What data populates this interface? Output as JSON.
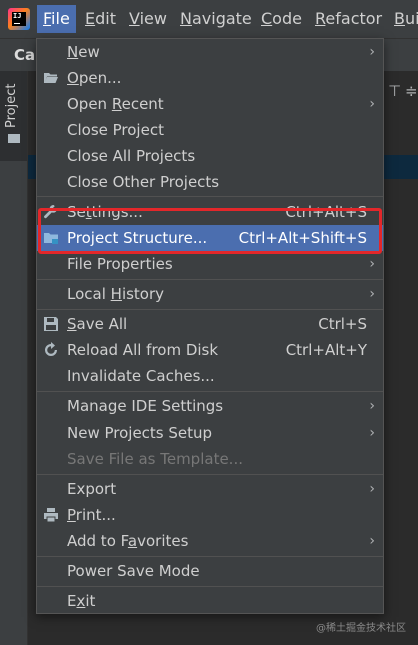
{
  "menubar": {
    "items": [
      {
        "label": "File",
        "mnemonic": "F",
        "rest": "ile"
      },
      {
        "label": "Edit",
        "mnemonic": "E",
        "rest": "dit"
      },
      {
        "label": "View",
        "mnemonic": "V",
        "rest": "iew"
      },
      {
        "label": "Navigate",
        "mnemonic": "N",
        "rest": "avigate"
      },
      {
        "label": "Code",
        "mnemonic": "C",
        "rest": "ode"
      },
      {
        "label": "Refactor",
        "mnemonic": "R",
        "rest": "efactor"
      },
      {
        "label": "Bui",
        "mnemonic": "B",
        "rest": "ui"
      }
    ]
  },
  "background": {
    "tab_text": "Ca",
    "tool_window_label": "Project"
  },
  "file_menu": {
    "items": [
      {
        "label": "New",
        "pre": "",
        "mn": "N",
        "post": "ew",
        "submenu": true
      },
      {
        "label": "Open...",
        "pre": "",
        "mn": "O",
        "post": "pen...",
        "icon": "folder-open-icon"
      },
      {
        "label": "Open Recent",
        "pre": "Open ",
        "mn": "R",
        "post": "ecent",
        "submenu": true
      },
      {
        "label": "Close Project",
        "pre": "Close Project",
        "mn": "",
        "post": ""
      },
      {
        "label": "Close All Projects",
        "pre": "Close All Projects",
        "mn": "",
        "post": ""
      },
      {
        "label": "Close Other Projects",
        "pre": "Close Other Projects",
        "mn": "",
        "post": ""
      },
      {
        "label": "Settings...",
        "pre": "Se",
        "mn": "t",
        "post": "tings...",
        "shortcut": "Ctrl+Alt+S",
        "icon": "wrench-icon"
      },
      {
        "label": "Project Structure...",
        "pre": "Project Structure...",
        "mn": "",
        "post": "",
        "shortcut": "Ctrl+Alt+Shift+S",
        "icon": "project-structure-icon",
        "highlighted": true
      },
      {
        "label": "File Properties",
        "pre": "File Properties",
        "mn": "",
        "post": "",
        "submenu": true
      },
      {
        "label": "Local History",
        "pre": "Local ",
        "mn": "H",
        "post": "istory",
        "submenu": true
      },
      {
        "label": "Save All",
        "pre": "",
        "mn": "S",
        "post": "ave All",
        "shortcut": "Ctrl+S",
        "icon": "save-icon"
      },
      {
        "label": "Reload All from Disk",
        "pre": "Reload All from Disk",
        "mn": "",
        "post": "",
        "shortcut": "Ctrl+Alt+Y",
        "icon": "reload-icon"
      },
      {
        "label": "Invalidate Caches...",
        "pre": "Invalidate Caches...",
        "mn": "",
        "post": ""
      },
      {
        "label": "Manage IDE Settings",
        "pre": "Manage IDE Settings",
        "mn": "",
        "post": "",
        "submenu": true
      },
      {
        "label": "New Projects Setup",
        "pre": "New Projects Setup",
        "mn": "",
        "post": "",
        "submenu": true
      },
      {
        "label": "Save File as Template...",
        "pre": "Save File as Template...",
        "mn": "",
        "post": "",
        "disabled": true
      },
      {
        "label": "Export",
        "pre": "Export",
        "mn": "",
        "post": "",
        "submenu": true
      },
      {
        "label": "Print...",
        "pre": "",
        "mn": "P",
        "post": "rint...",
        "icon": "print-icon"
      },
      {
        "label": "Add to Favorites",
        "pre": "Add to F",
        "mn": "a",
        "post": "vorites",
        "submenu": true
      },
      {
        "label": "Power Save Mode",
        "pre": "Power Save Mode",
        "mn": "",
        "post": ""
      },
      {
        "label": "Exit",
        "pre": "E",
        "mn": "x",
        "post": "it"
      }
    ]
  },
  "watermark": "@稀土掘金技术社区",
  "colors": {
    "menubar_bg": "#3c3f41",
    "highlight": "#4b6eaf",
    "annotation_box": "#e3272a"
  }
}
